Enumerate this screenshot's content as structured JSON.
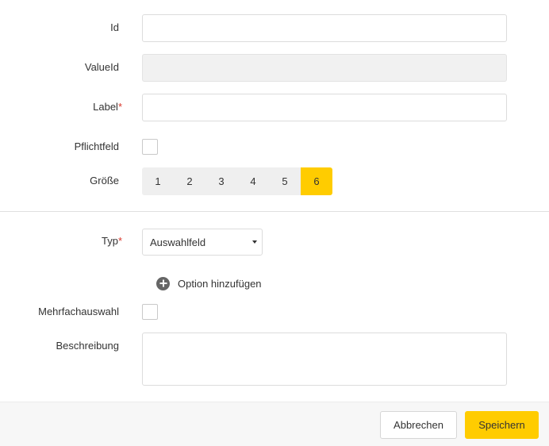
{
  "form": {
    "id": {
      "label": "Id",
      "value": ""
    },
    "value_id": {
      "label": "ValueId",
      "value": ""
    },
    "label_field": {
      "label": "Label",
      "required_mark": "*",
      "value": ""
    },
    "required": {
      "label": "Pflichtfeld",
      "checked": false
    },
    "size": {
      "label": "Größe",
      "options": [
        "1",
        "2",
        "3",
        "4",
        "5",
        "6"
      ],
      "selected": "6"
    },
    "type": {
      "label": "Typ",
      "required_mark": "*",
      "value": "Auswahlfeld"
    },
    "add_option": {
      "label": "Option hinzufügen"
    },
    "multi_select": {
      "label": "Mehrfachauswahl",
      "checked": false
    },
    "description": {
      "label": "Beschreibung",
      "value": ""
    }
  },
  "footer": {
    "cancel_label": "Abbrechen",
    "save_label": "Speichern"
  },
  "colors": {
    "accent": "#ffcc00",
    "required": "#d9372b"
  }
}
